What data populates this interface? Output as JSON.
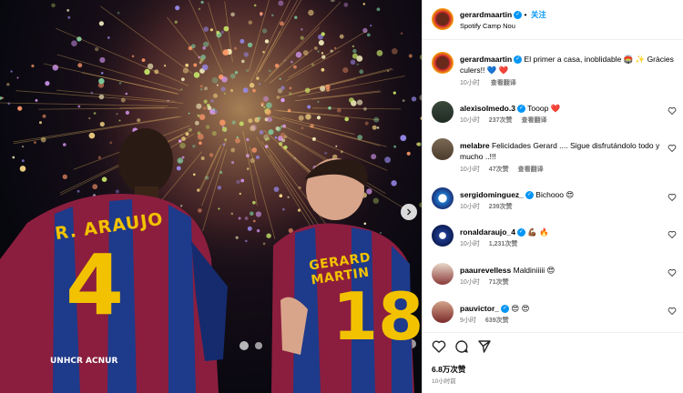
{
  "post": {
    "username": "gerardmaartin",
    "follow_label": "关注",
    "location": "Spotify Camp Nou",
    "caption": "El primer a casa, inoblidable 🏟️ ✨ Gràcies culers!! 💙 ❤️",
    "caption_time": "10小时",
    "caption_translate": "查看翻译",
    "likes": "6.8万次赞",
    "posted_ago": "10小时前"
  },
  "photo": {
    "jersey_left_name": "R. ARAUJO",
    "jersey_left_number": "4",
    "jersey_right_name": "GERARD MARTIN",
    "jersey_right_number": "18",
    "sponsor": "UNHCR ACNUR"
  },
  "comments": [
    {
      "user": "alexisolmedo.3",
      "verified": true,
      "text": "Tooop ❤️",
      "time": "10小时",
      "likes": "237次赞",
      "translate": "查看翻译"
    },
    {
      "user": "melabre",
      "verified": false,
      "text": "Felicidades Gerard .... Sigue disfrutándolo todo y mucho ..!!!",
      "time": "10小时",
      "likes": "47次赞",
      "translate": "查看翻译"
    },
    {
      "user": "sergidominguez_",
      "verified": true,
      "text": "Bichooo 😍",
      "time": "10小时",
      "likes": "239次赞",
      "translate": ""
    },
    {
      "user": "ronaldaraujo_4",
      "verified": true,
      "text": "💪🏾 🔥",
      "time": "10小时",
      "likes": "1,231次赞",
      "translate": ""
    },
    {
      "user": "paaurevelless",
      "verified": false,
      "text": "Maldiniiiii 😍",
      "time": "10小时",
      "likes": "71次赞",
      "translate": ""
    },
    {
      "user": "pauvictor_",
      "verified": true,
      "text": "😍 😍",
      "time": "9小时",
      "likes": "639次赞",
      "translate": ""
    }
  ]
}
